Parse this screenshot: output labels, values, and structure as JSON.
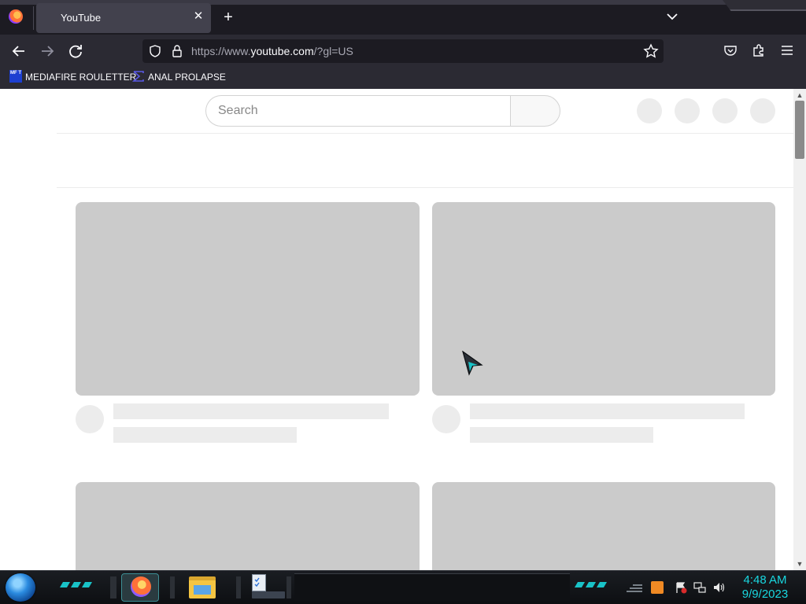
{
  "browser": {
    "tab": {
      "title": "YouTube"
    },
    "url": {
      "prefix": "https://www.",
      "domain": "youtube.com",
      "suffix": "/?gl=US"
    },
    "bookmarks": [
      {
        "label": "MEDIAFIRE ROULETTER",
        "icon": "mft-icon",
        "icon_text": "MF T"
      },
      {
        "label": "ANAL PROLAPSE",
        "icon": "sigma-icon"
      }
    ]
  },
  "youtube": {
    "search": {
      "placeholder": "Search"
    },
    "header_buttons": [
      "loading-placeholder",
      "loading-placeholder",
      "loading-placeholder",
      "loading-placeholder"
    ],
    "video_placeholders": 4
  },
  "taskbar": {
    "apps": [
      "firefox",
      "file-explorer",
      "task-manager"
    ],
    "clock": {
      "time": "4:48 AM",
      "date": "9/9/2023"
    }
  },
  "colors": {
    "accent_cyan": "#19c3c8",
    "skeleton_gray": "#cbcbcb",
    "skeleton_light": "#ececec"
  }
}
